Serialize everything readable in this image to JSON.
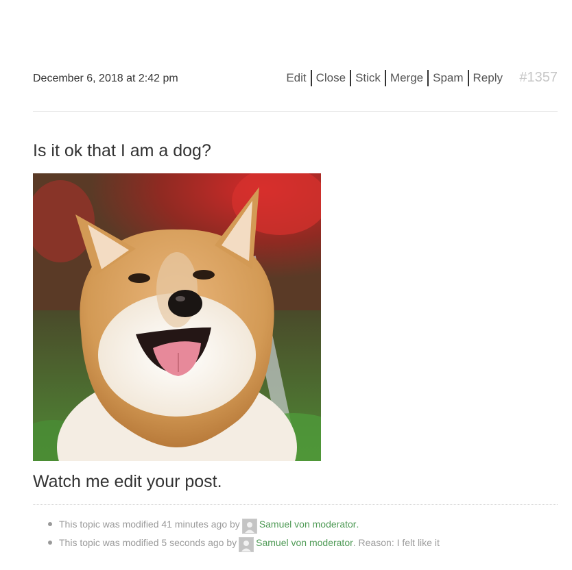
{
  "post": {
    "date": "December 6, 2018 at 2:42 pm",
    "permalink": "#1357",
    "admin_links": {
      "edit": "Edit",
      "close": "Close",
      "stick": "Stick",
      "merge": "Merge",
      "spam": "Spam",
      "reply": "Reply"
    },
    "title": "Is it ok that I am a dog?",
    "body": "Watch me edit your post."
  },
  "revisions": [
    {
      "prefix": "This topic was modified 41 minutes ago by",
      "author": "Samuel von moderator",
      "suffix": "."
    },
    {
      "prefix": "This topic was modified 5 seconds ago by",
      "author": "Samuel von moderator",
      "suffix": ". Reason: I felt like it"
    }
  ],
  "colors": {
    "link_green": "#4e9a55",
    "permalink_gray": "#c7c7c7"
  }
}
